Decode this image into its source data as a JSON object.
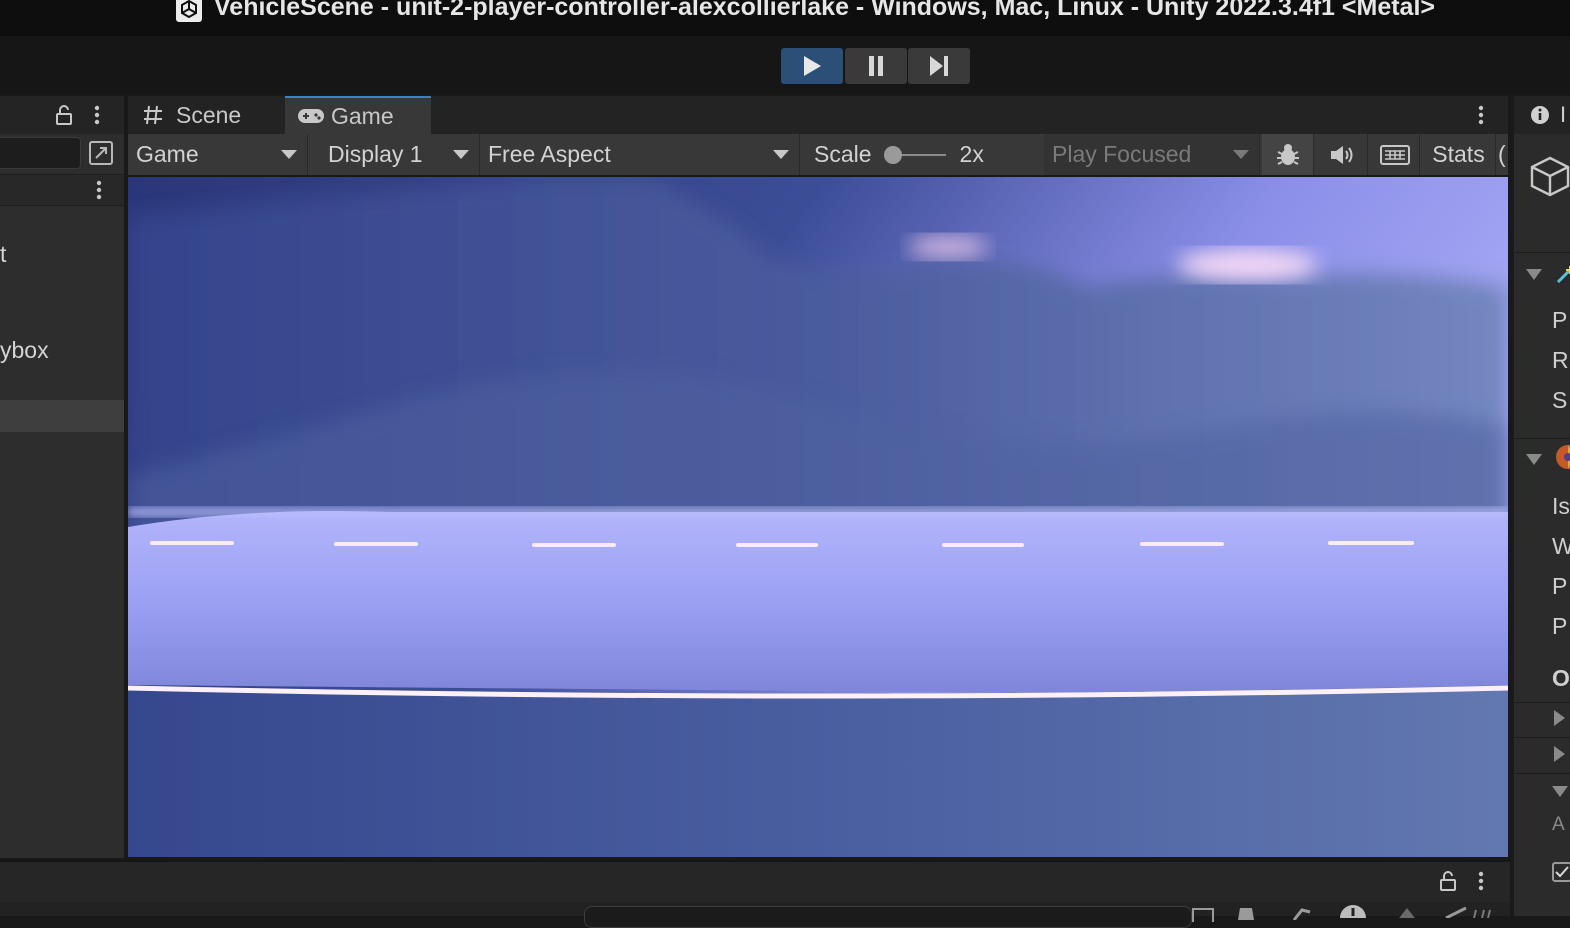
{
  "window": {
    "title": "VehicleScene - unit-2-player-controller-alexcollierlake - Windows, Mac, Linux - Unity 2022.3.4f1 <Metal>"
  },
  "playbar": {
    "play_icon": "play-icon",
    "pause_icon": "pause-icon",
    "step_icon": "step-icon",
    "play_active_color": "#2c4f78"
  },
  "left_panel": {
    "items": [
      {
        "label": "t"
      },
      {
        "label": "ybox"
      }
    ]
  },
  "center": {
    "tabs": [
      {
        "label": "Scene",
        "icon": "hash-icon"
      },
      {
        "label": "Game",
        "icon": "gamepad-icon",
        "active": true
      }
    ],
    "controls": {
      "game_dropdown": "Game",
      "display_dropdown": "Display 1",
      "aspect_dropdown": "Free Aspect",
      "scale_label": "Scale",
      "scale_value": "2x",
      "play_mode_dropdown": "Play Focused",
      "stats_label": "Stats"
    }
  },
  "inspector": {
    "tab_letter": "I",
    "letters": [
      "P",
      "R",
      "S",
      "Is",
      "W",
      "P",
      "P",
      "O",
      "A"
    ]
  }
}
